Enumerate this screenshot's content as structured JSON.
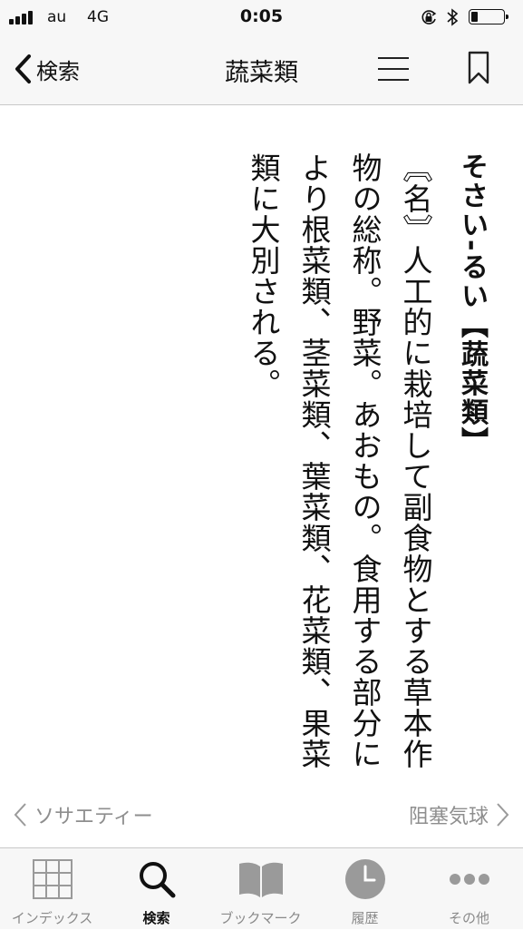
{
  "status_bar": {
    "carrier": "au",
    "network": "4G",
    "time": "0:05",
    "icons": [
      "signal-icon",
      "orientation-lock-icon",
      "bluetooth-icon",
      "battery-icon"
    ]
  },
  "nav": {
    "back_label": "検索",
    "title": "蔬菜類",
    "icons": [
      "chevron-left-icon",
      "menu-icon",
      "bookmark-icon"
    ]
  },
  "entry": {
    "headword": "そさい‐るい【蔬菜類】",
    "body": "〘名〙人工的に栽培して副食物とする草本作物の総称。野菜。あおもの。食用する部分により根菜類、茎菜類、葉菜類、花菜類、果菜類に大別される。"
  },
  "pager": {
    "prev": "ソサエティー",
    "next": "阻塞気球"
  },
  "tabs": [
    {
      "label": "インデックス",
      "icon": "grid-icon",
      "active": false
    },
    {
      "label": "検索",
      "icon": "search-icon",
      "active": true
    },
    {
      "label": "ブックマーク",
      "icon": "book-icon",
      "active": false
    },
    {
      "label": "履歴",
      "icon": "clock-icon",
      "active": false
    },
    {
      "label": "その他",
      "icon": "more-icon",
      "active": false
    }
  ],
  "colors": {
    "bar_background": "#f7f7f7",
    "active": "#111111",
    "inactive": "#8a8a8a",
    "pager_text": "#8e8e8e"
  }
}
